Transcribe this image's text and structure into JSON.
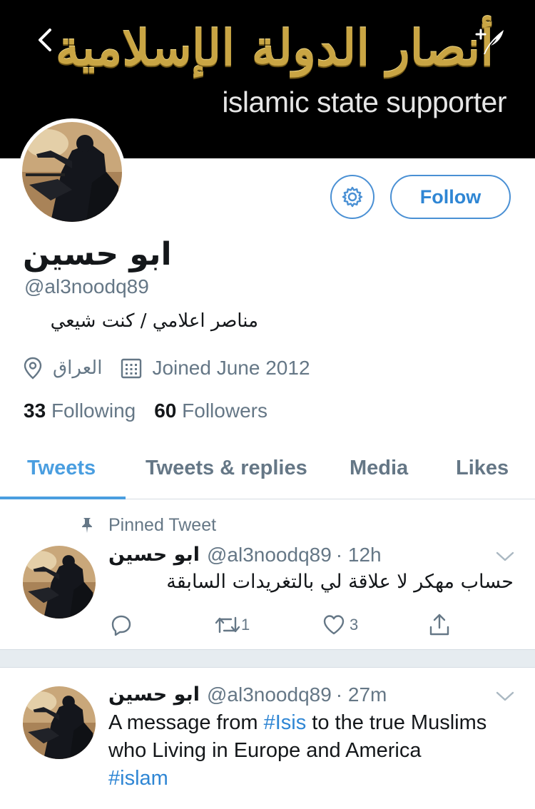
{
  "banner": {
    "arabic_text": "أنصار الدولة الإسلامية",
    "english_text": "islamic state supporter"
  },
  "header": {
    "back_icon": "chevron-left-icon",
    "compose_icon": "compose-quill-icon"
  },
  "profile": {
    "display_name": "ابو حسين",
    "handle": "@al3noodq89",
    "bio": "مناصر اعلامي / كنت شيعي",
    "location": "العراق",
    "joined": "Joined June 2012",
    "following_count": "33",
    "following_label": "Following",
    "followers_count": "60",
    "followers_label": "Followers",
    "follow_label": "Follow",
    "accent_color": "#4a90d4"
  },
  "tabs": [
    {
      "label": "Tweets",
      "active": true
    },
    {
      "label": "Tweets & replies",
      "active": false
    },
    {
      "label": "Media",
      "active": false
    },
    {
      "label": "Likes",
      "active": false
    }
  ],
  "tweets": [
    {
      "pinned_label": "Pinned Tweet",
      "name": "ابو حسين",
      "handle": "@al3noodq89",
      "time": "· 12h",
      "text": "حساب مهكر لا علاقة لي بالتغريدات السابقة",
      "retweets": "1",
      "likes": "3"
    },
    {
      "name": "ابو حسين",
      "handle": "@al3noodq89",
      "time": "· 27m",
      "text_part1": "A message from ",
      "hashtag1": "#Isis",
      "text_part2": " to the true Muslims who Living in Europe and America",
      "hashtag2": "#islam"
    }
  ]
}
